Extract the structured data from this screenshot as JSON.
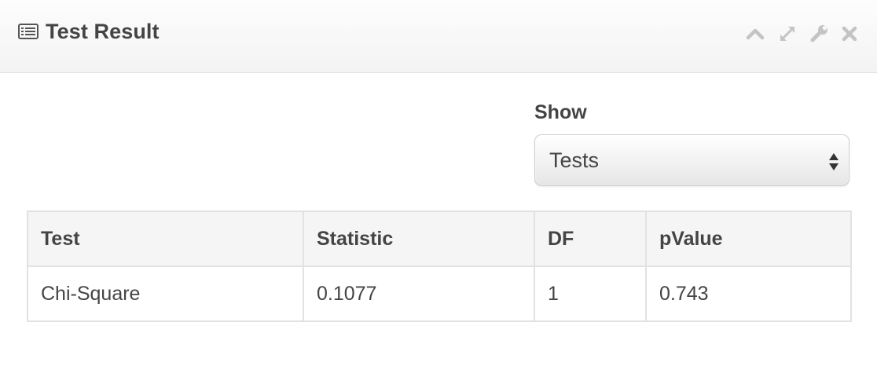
{
  "panel": {
    "title": "Test Result",
    "title_icon": "list-icon",
    "controls": [
      "collapse-icon",
      "expand-icon",
      "wrench-icon",
      "close-icon"
    ]
  },
  "filter": {
    "label": "Show",
    "selected": "Tests"
  },
  "table": {
    "headers": [
      "Test",
      "Statistic",
      "DF",
      "pValue"
    ],
    "rows": [
      [
        "Chi-Square",
        "0.1077",
        "1",
        "0.743"
      ]
    ]
  },
  "colors": {
    "icon_gray": "#c4c4c4",
    "text": "#444444",
    "border": "#e2e2e2",
    "header_bg": "#f5f5f5"
  }
}
